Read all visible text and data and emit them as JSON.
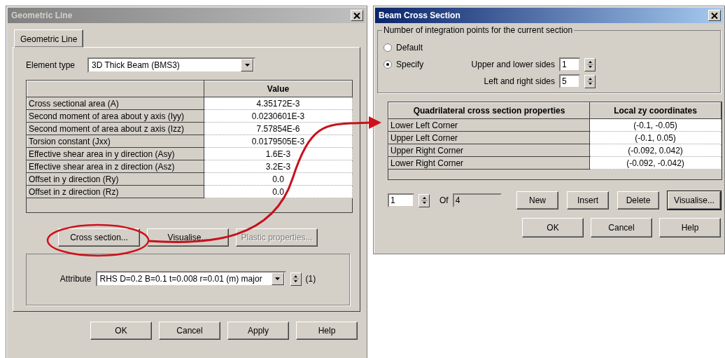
{
  "geometric_line_dialog": {
    "title": "Geometric Line",
    "active": false,
    "tabs": [
      {
        "label": "Geometric Line",
        "selected": true
      }
    ],
    "element_type": {
      "label": "Element type",
      "value": "3D Thick Beam (BMS3)"
    },
    "properties_table": {
      "columns": [
        "",
        "Value"
      ],
      "rows": [
        {
          "name": "Cross sectional area (A)",
          "value": "4.35172E-3"
        },
        {
          "name": "Second moment of area about y axis (Iyy)",
          "value": "0.0230601E-3"
        },
        {
          "name": "Second moment of area about z axis (Izz)",
          "value": "7.57854E-6"
        },
        {
          "name": "Torsion constant (Jxx)",
          "value": "0.0179505E-3"
        },
        {
          "name": "Effective shear area in y direction (Asy)",
          "value": "1.6E-3"
        },
        {
          "name": "Effective shear area in z direction (Asz)",
          "value": "3.2E-3"
        },
        {
          "name": "Offset in y direction (Ry)",
          "value": "0.0"
        },
        {
          "name": "Offset in z direction (Rz)",
          "value": "0.0"
        }
      ]
    },
    "section_buttons": [
      {
        "label": "Cross section...",
        "disabled": false
      },
      {
        "label": "Visualise...",
        "disabled": false
      },
      {
        "label": "Plastic properties...",
        "disabled": true
      }
    ],
    "attribute": {
      "label": "Attribute",
      "value": "RHS D=0.2 B=0.1 t=0.008 r=0.01 (m) major",
      "index": "(1)"
    },
    "buttons": [
      "OK",
      "Cancel",
      "Apply",
      "Help"
    ]
  },
  "beam_cross_section_dialog": {
    "title": "Beam Cross Section",
    "active": true,
    "integration_points": {
      "legend": "Number of integration points for the current section",
      "options": [
        {
          "label": "Default",
          "selected": false
        },
        {
          "label": "Specify",
          "selected": true
        }
      ],
      "fields": [
        {
          "label": "Upper and lower sides",
          "value": "1"
        },
        {
          "label": "Left and right sides",
          "value": "5"
        }
      ]
    },
    "corners_table": {
      "columns": [
        "Quadrilateral cross section properties",
        "Local zy coordinates"
      ],
      "rows": [
        {
          "name": "Lower Left Corner",
          "value": "(-0.1, -0.05)"
        },
        {
          "name": "Upper Left Corner",
          "value": "(-0.1, 0.05)"
        },
        {
          "name": "Upper Right Corner",
          "value": "(-0.092, 0.042)"
        },
        {
          "name": "Lower Right Corner",
          "value": "(-0.092, -0.042)"
        }
      ]
    },
    "navigator": {
      "current": "1",
      "of_label": "Of",
      "total": "4"
    },
    "row_buttons": [
      {
        "label": "New",
        "default": false
      },
      {
        "label": "Insert",
        "default": false
      },
      {
        "label": "Delete",
        "default": false
      },
      {
        "label": "Visualise...",
        "default": true
      }
    ],
    "buttons": [
      "OK",
      "Cancel",
      "Help"
    ]
  }
}
